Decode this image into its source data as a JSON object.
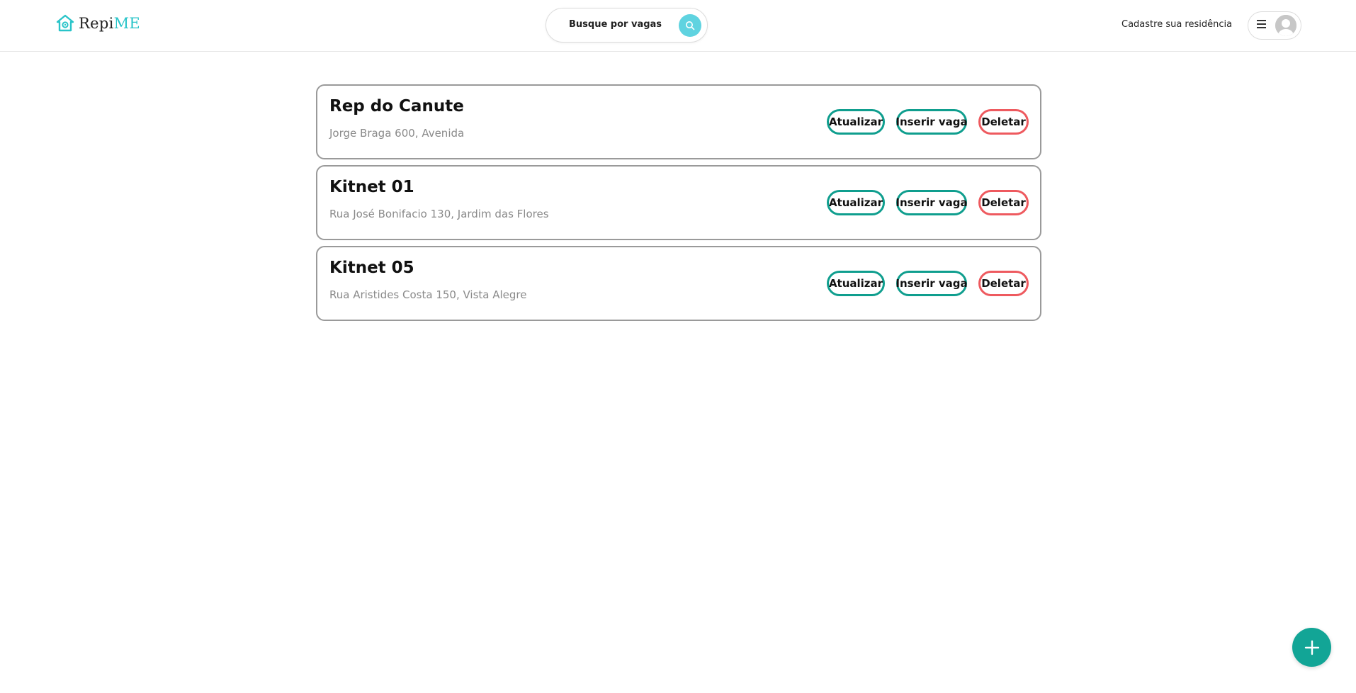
{
  "header": {
    "logo": {
      "text_main": "Repi",
      "text_accent": "ME",
      "icon": "house-logo-icon",
      "accent_color": "#29c4c9"
    },
    "search": {
      "label": "Busque por vagas",
      "icon": "search-icon",
      "button_color": "#5fd3e0"
    },
    "host_link": "Cadastre sua residência",
    "user_menu": {
      "menu_icon": "hamburger-icon",
      "avatar_icon": "user-avatar-icon"
    }
  },
  "residences": [
    {
      "title": "Rep do Canute",
      "address": "Jorge Braga 600, Avenida"
    },
    {
      "title": "Kitnet 01",
      "address": "Rua José Bonifacio 130, Jardim das Flores"
    },
    {
      "title": "Kitnet 05",
      "address": "Rua Aristides Costa 150, Vista Alegre"
    }
  ],
  "actions": {
    "update_label": "Atualizar",
    "insert_label": "Inserir vaga",
    "delete_label": "Deletar",
    "primary_color": "#0f9e8e",
    "danger_color": "#ee5a5f"
  },
  "fab": {
    "icon": "plus-icon",
    "color": "#12a596"
  }
}
